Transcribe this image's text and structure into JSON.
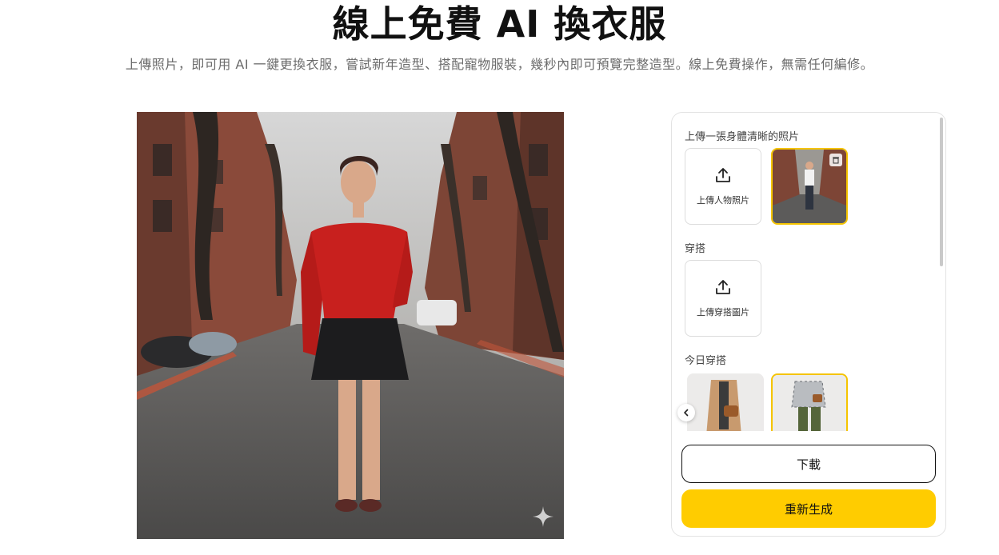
{
  "header": {
    "title_part1": "線上",
    "title_highlight": "免費",
    "title_part2": " AI 換衣服",
    "subtitle": "上傳照片，即可用 AI 一鍵更換衣服，嘗試新年造型、搭配寵物服裝，幾秒內即可預覽完整造型。線上免費操作，無需任何編修。"
  },
  "panel": {
    "person_section_label": "上傳一張身體清晰的照片",
    "upload_person_label": "上傳人物照片",
    "outfit_section_label": "穿搭",
    "upload_outfit_label": "上傳穿搭圖片",
    "today_section_label": "今日穿搭",
    "download_label": "下載",
    "regenerate_label": "重新生成"
  },
  "icons": {
    "upload": "upload-icon",
    "delete": "trash-icon",
    "prev": "chevron-left-icon",
    "sparkle": "sparkle-icon"
  },
  "colors": {
    "accent": "#ffcc00",
    "selected_border": "#f5c400",
    "sweater": "#c8201e"
  }
}
